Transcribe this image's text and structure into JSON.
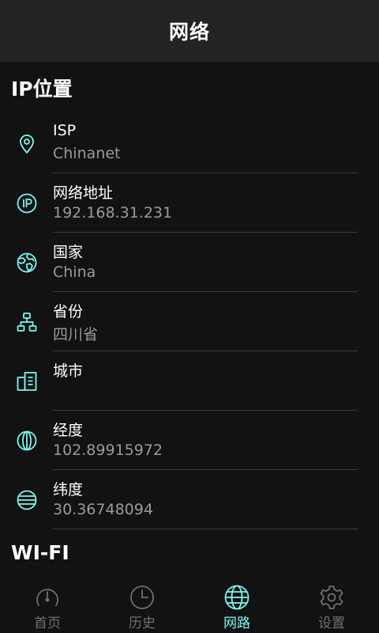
{
  "header": {
    "title": "网络"
  },
  "ip_section": {
    "title": "IP位置"
  },
  "rows": [
    {
      "label": "ISP",
      "value": "Chinanet",
      "icon": "location-pin-icon"
    },
    {
      "label": "网络地址",
      "value": "192.168.31.231",
      "icon": "ip-icon"
    },
    {
      "label": "国家",
      "value": "China",
      "icon": "globe-icon"
    },
    {
      "label": "省份",
      "value": "四川省",
      "icon": "hierarchy-icon"
    },
    {
      "label": "城市",
      "value": "",
      "icon": "building-icon"
    },
    {
      "label": "经度",
      "value": "102.89915972",
      "icon": "longitude-icon"
    },
    {
      "label": "纬度",
      "value": "30.36748094",
      "icon": "latitude-icon"
    }
  ],
  "wifi_section": {
    "title": "WI-FI"
  },
  "nav": [
    {
      "label": "首页",
      "icon": "speedometer-icon",
      "active": false
    },
    {
      "label": "历史",
      "icon": "clock-icon",
      "active": false
    },
    {
      "label": "网路",
      "icon": "globe-icon",
      "active": true
    },
    {
      "label": "设置",
      "icon": "gear-icon",
      "active": false
    }
  ],
  "colors": {
    "accent": "#7ff6ee",
    "background": "#121212",
    "header": "#232323",
    "muted": "#9a9a9a"
  }
}
